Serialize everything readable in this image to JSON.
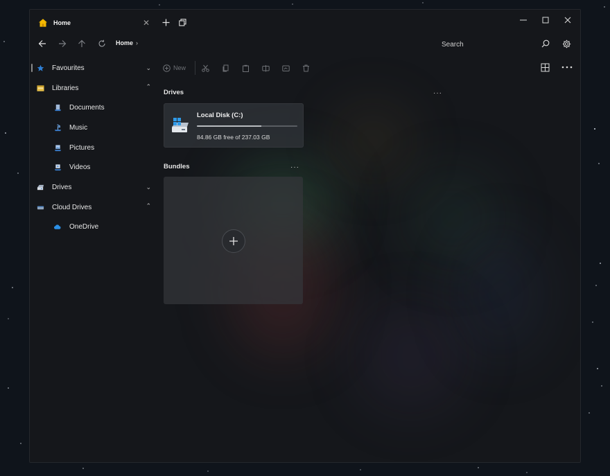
{
  "tab": {
    "title": "Home"
  },
  "breadcrumb": {
    "current": "Home"
  },
  "search": {
    "placeholder": "Search"
  },
  "sidebar": {
    "items": [
      {
        "label": "Favourites",
        "icon": "star-icon"
      },
      {
        "label": "Libraries",
        "icon": "libraries-icon"
      },
      {
        "label": "Documents",
        "icon": "documents-icon"
      },
      {
        "label": "Music",
        "icon": "music-icon"
      },
      {
        "label": "Pictures",
        "icon": "pictures-icon"
      },
      {
        "label": "Videos",
        "icon": "videos-icon"
      },
      {
        "label": "Drives",
        "icon": "drive-icon"
      },
      {
        "label": "Cloud Drives",
        "icon": "cloud-drives-icon"
      },
      {
        "label": "OneDrive",
        "icon": "onedrive-icon"
      }
    ]
  },
  "toolbar": {
    "new_label": "New"
  },
  "drives": {
    "title": "Drives",
    "items": [
      {
        "name": "Local Disk (C:)",
        "free_text": "84.86 GB free of 237.03 GB",
        "used_fraction": 0.642
      }
    ]
  },
  "bundles": {
    "title": "Bundles"
  },
  "colors": {
    "window_bg": "#15171b",
    "card_bg": "#303338",
    "accent_blue": "#2f80d6",
    "home_yellow": "#f5b800",
    "onedrive_blue": "#2b8fe5"
  }
}
